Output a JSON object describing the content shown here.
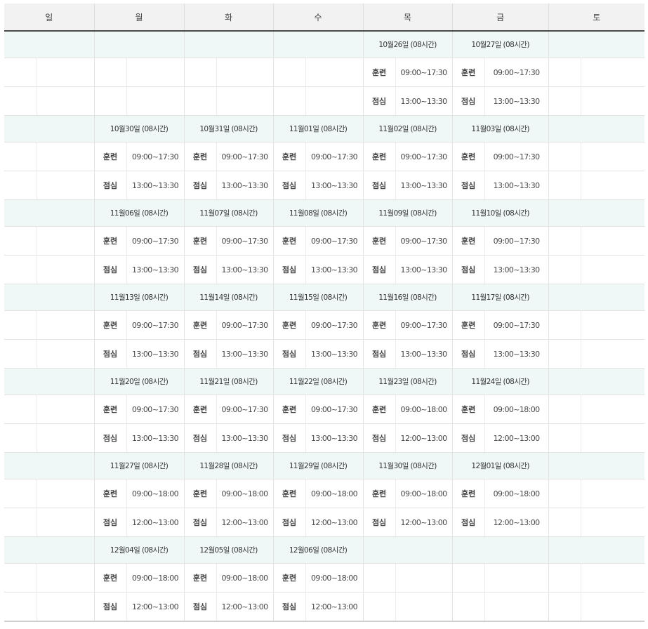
{
  "header": {
    "days": [
      "일",
      "월",
      "화",
      "수",
      "목",
      "금",
      "토"
    ]
  },
  "labels": {
    "training": "훈련",
    "lunch": "점심"
  },
  "weeks": [
    {
      "days": [
        null,
        null,
        null,
        null,
        {
          "date": "10월26일 (08시간)",
          "train": "09:00~17:30",
          "lunch": "13:00~13:30"
        },
        {
          "date": "10월27일 (08시간)",
          "train": "09:00~17:30",
          "lunch": "13:00~13:30"
        },
        null
      ]
    },
    {
      "days": [
        null,
        {
          "date": "10월30일 (08시간)",
          "train": "09:00~17:30",
          "lunch": "13:00~13:30"
        },
        {
          "date": "10월31일 (08시간)",
          "train": "09:00~17:30",
          "lunch": "13:00~13:30"
        },
        {
          "date": "11월01일 (08시간)",
          "train": "09:00~17:30",
          "lunch": "13:00~13:30"
        },
        {
          "date": "11월02일 (08시간)",
          "train": "09:00~17:30",
          "lunch": "13:00~13:30"
        },
        {
          "date": "11월03일 (08시간)",
          "train": "09:00~17:30",
          "lunch": "13:00~13:30"
        },
        null
      ]
    },
    {
      "days": [
        null,
        {
          "date": "11월06일 (08시간)",
          "train": "09:00~17:30",
          "lunch": "13:00~13:30"
        },
        {
          "date": "11월07일 (08시간)",
          "train": "09:00~17:30",
          "lunch": "13:00~13:30"
        },
        {
          "date": "11월08일 (08시간)",
          "train": "09:00~17:30",
          "lunch": "13:00~13:30"
        },
        {
          "date": "11월09일 (08시간)",
          "train": "09:00~17:30",
          "lunch": "13:00~13:30"
        },
        {
          "date": "11월10일 (08시간)",
          "train": "09:00~17:30",
          "lunch": "13:00~13:30"
        },
        null
      ]
    },
    {
      "days": [
        null,
        {
          "date": "11월13일 (08시간)",
          "train": "09:00~17:30",
          "lunch": "13:00~13:30"
        },
        {
          "date": "11월14일 (08시간)",
          "train": "09:00~17:30",
          "lunch": "13:00~13:30"
        },
        {
          "date": "11월15일 (08시간)",
          "train": "09:00~17:30",
          "lunch": "13:00~13:30"
        },
        {
          "date": "11월16일 (08시간)",
          "train": "09:00~17:30",
          "lunch": "13:00~13:30"
        },
        {
          "date": "11월17일 (08시간)",
          "train": "09:00~17:30",
          "lunch": "13:00~13:30"
        },
        null
      ]
    },
    {
      "days": [
        null,
        {
          "date": "11월20일 (08시간)",
          "train": "09:00~17:30",
          "lunch": "13:00~13:30"
        },
        {
          "date": "11월21일 (08시간)",
          "train": "09:00~17:30",
          "lunch": "13:00~13:30"
        },
        {
          "date": "11월22일 (08시간)",
          "train": "09:00~17:30",
          "lunch": "13:00~13:30"
        },
        {
          "date": "11월23일 (08시간)",
          "train": "09:00~18:00",
          "lunch": "12:00~13:00"
        },
        {
          "date": "11월24일 (08시간)",
          "train": "09:00~18:00",
          "lunch": "12:00~13:00"
        },
        null
      ]
    },
    {
      "days": [
        null,
        {
          "date": "11월27일 (08시간)",
          "train": "09:00~18:00",
          "lunch": "12:00~13:00"
        },
        {
          "date": "11월28일 (08시간)",
          "train": "09:00~18:00",
          "lunch": "12:00~13:00"
        },
        {
          "date": "11월29일 (08시간)",
          "train": "09:00~18:00",
          "lunch": "12:00~13:00"
        },
        {
          "date": "11월30일 (08시간)",
          "train": "09:00~18:00",
          "lunch": "12:00~13:00"
        },
        {
          "date": "12월01일 (08시간)",
          "train": "09:00~18:00",
          "lunch": "12:00~13:00"
        },
        null
      ]
    },
    {
      "days": [
        null,
        {
          "date": "12월04일 (08시간)",
          "train": "09:00~18:00",
          "lunch": "12:00~13:00"
        },
        {
          "date": "12월05일 (08시간)",
          "train": "09:00~18:00",
          "lunch": "12:00~13:00"
        },
        {
          "date": "12월06일 (08시간)",
          "train": "09:00~18:00",
          "lunch": "12:00~13:00"
        },
        null,
        null,
        null
      ]
    }
  ]
}
